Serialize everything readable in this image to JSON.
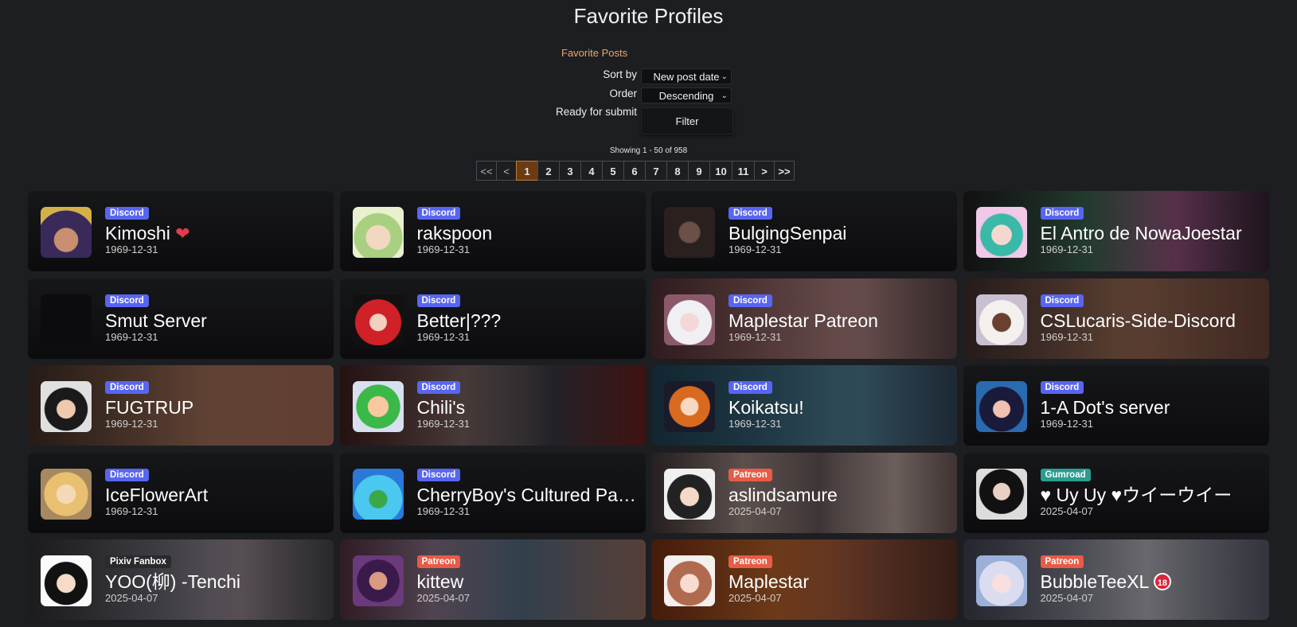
{
  "page": {
    "title": "Favorite Profiles",
    "favorite_posts_link": "Favorite Posts"
  },
  "filter_form": {
    "sort_by_label": "Sort by",
    "sort_by_value": "New post date",
    "order_label": "Order",
    "order_value": "Descending",
    "submit_label": "Ready for submit",
    "filter_button": "Filter"
  },
  "pagination": {
    "showing": "Showing 1 - 50 of 958",
    "first": "<<",
    "prev": "<",
    "pages": [
      "1",
      "2",
      "3",
      "4",
      "5",
      "6",
      "7",
      "8",
      "9",
      "10",
      "11"
    ],
    "current": "1",
    "next": ">",
    "last": ">>"
  },
  "colors": {
    "discord": "#5865f2",
    "patreon": "#e85b46",
    "gumroad": "#2a9d8f",
    "fanbox": "#2a2a2c",
    "accent": "#e8a66b"
  },
  "profiles": [
    {
      "service": "Discord",
      "name": "Kimoshi",
      "date": "1969-12-31",
      "icon": "heart-emoji"
    },
    {
      "service": "Discord",
      "name": "rakspoon",
      "date": "1969-12-31"
    },
    {
      "service": "Discord",
      "name": "BulgingSenpai",
      "date": "1969-12-31"
    },
    {
      "service": "Discord",
      "name": "El Antro de NowaJoestar",
      "date": "1969-12-31"
    },
    {
      "service": "Discord",
      "name": "Smut Server",
      "date": "1969-12-31"
    },
    {
      "service": "Discord",
      "name": "Better|???",
      "date": "1969-12-31"
    },
    {
      "service": "Discord",
      "name": "Maplestar Patreon",
      "date": "1969-12-31"
    },
    {
      "service": "Discord",
      "name": "CSLucaris-Side-Discord",
      "date": "1969-12-31"
    },
    {
      "service": "Discord",
      "name": "FUGTRUP",
      "date": "1969-12-31"
    },
    {
      "service": "Discord",
      "name": "Chili's",
      "date": "1969-12-31"
    },
    {
      "service": "Discord",
      "name": "Koikatsu!",
      "date": "1969-12-31"
    },
    {
      "service": "Discord",
      "name": "1-A Dot's server",
      "date": "1969-12-31"
    },
    {
      "service": "Discord",
      "name": "IceFlowerArt",
      "date": "1969-12-31"
    },
    {
      "service": "Discord",
      "name": "CherryBoy's Cultured Palace",
      "date": "1969-12-31"
    },
    {
      "service": "Patreon",
      "name": "aslindsamure",
      "date": "2025-04-07"
    },
    {
      "service": "Gumroad",
      "name": "♥ Uy Uy ♥ウイーウイー",
      "date": "2025-04-07"
    },
    {
      "service": "Pixiv Fanbox",
      "name": "YOO(柳) -Tenchi",
      "date": "2025-04-07"
    },
    {
      "service": "Patreon",
      "name": "kittew",
      "date": "2025-04-07"
    },
    {
      "service": "Patreon",
      "name": "Maplestar",
      "date": "2025-04-07"
    },
    {
      "service": "Patreon",
      "name": "BubbleTeeXL",
      "date": "2025-04-07",
      "icon": "r18-emoji",
      "icon_text": "18"
    }
  ]
}
